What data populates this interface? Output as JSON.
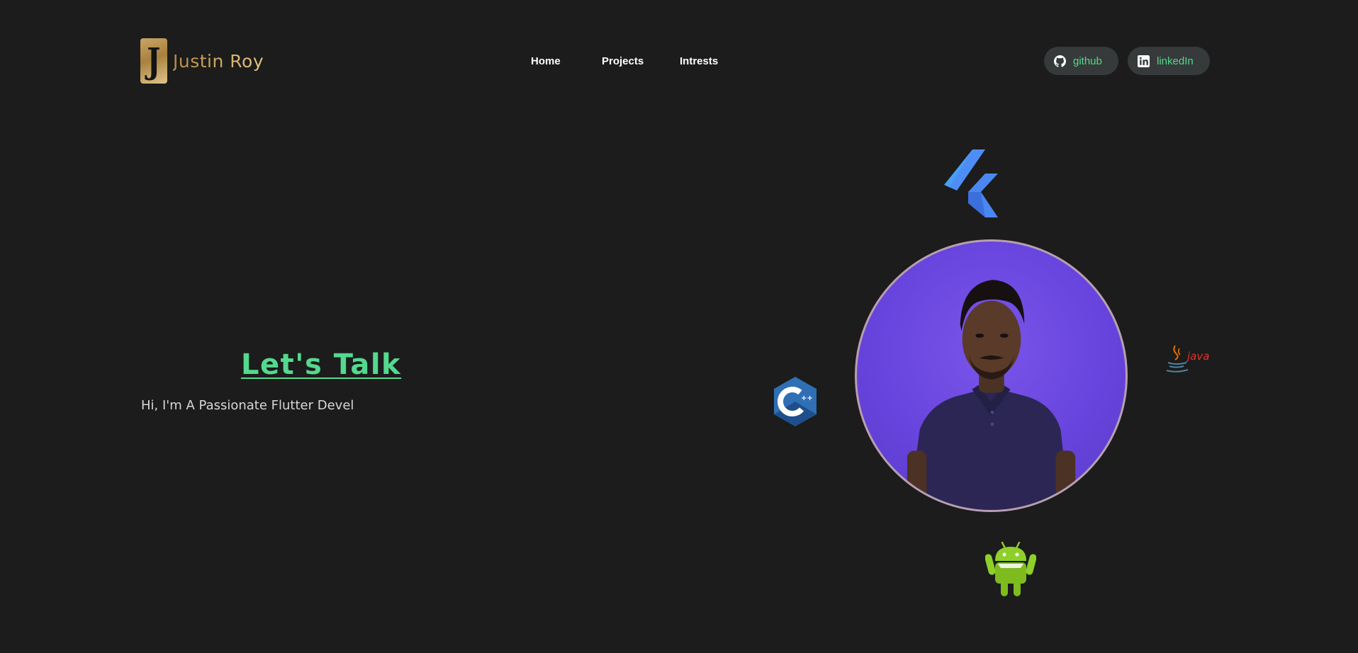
{
  "header": {
    "logo_letter": "J",
    "logo_name": "Justin Roy",
    "nav": [
      {
        "label": "Home"
      },
      {
        "label": "Projects"
      },
      {
        "label": "Intrests"
      }
    ],
    "social": {
      "github": {
        "label": "github",
        "icon": "github-icon"
      },
      "linkedin": {
        "label": "linkedIn",
        "icon": "linkedin-icon"
      }
    }
  },
  "hero": {
    "title": "Let's Talk",
    "subtitle": "Hi, I'm A Passionate Flutter Devel"
  },
  "skills": {
    "java_label": "Java",
    "cpp_label": "C++"
  },
  "colors": {
    "background": "#1b1c1b",
    "accent_green": "#55d88f",
    "gold": "#d2ac63",
    "pill_bg": "#373a3a",
    "portrait_bg": "#6744dd"
  }
}
